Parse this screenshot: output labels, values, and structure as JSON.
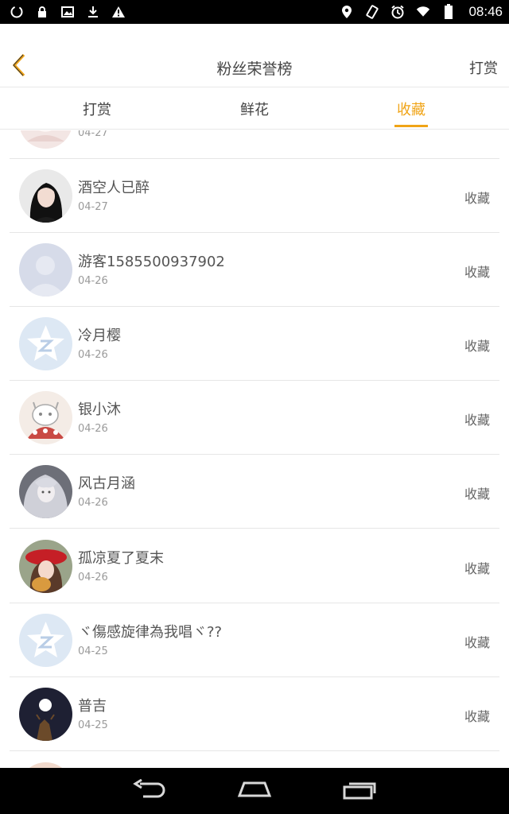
{
  "status_bar": {
    "time": "08:46",
    "left_icons": [
      "sync-icon",
      "lock-icon",
      "image-icon",
      "download-icon",
      "warning-icon"
    ],
    "right_icons": [
      "location-icon",
      "rotate-icon",
      "alarm-icon",
      "wifi-icon",
      "battery-icon"
    ]
  },
  "header": {
    "title": "粉丝荣誉榜",
    "right_label": "打赏",
    "back_icon": "chevron-left-icon",
    "accent_color": "#f0a417"
  },
  "tabs": [
    {
      "label": "打赏",
      "active": false
    },
    {
      "label": "鲜花",
      "active": false
    },
    {
      "label": "收藏",
      "active": true
    }
  ],
  "list": {
    "partial_top": {
      "date": "04-27"
    },
    "items": [
      {
        "name": "酒空人已醉",
        "date": "04-27",
        "action": "收藏",
        "avatar": "photo-dark-hair"
      },
      {
        "name": "游客1585500937902",
        "date": "04-26",
        "action": "收藏",
        "avatar": "default-person"
      },
      {
        "name": "冷月樱",
        "date": "04-26",
        "action": "收藏",
        "avatar": "qzone-default"
      },
      {
        "name": "银小沐",
        "date": "04-26",
        "action": "收藏",
        "avatar": "cartoon-cat"
      },
      {
        "name": "风古月涵",
        "date": "04-26",
        "action": "收藏",
        "avatar": "anime-girl"
      },
      {
        "name": "孤凉夏了夏末",
        "date": "04-26",
        "action": "收藏",
        "avatar": "red-hat-girl"
      },
      {
        "name": "ヾ傷感旋律為我唱ヾ??",
        "date": "04-25",
        "action": "收藏",
        "avatar": "qzone-default"
      },
      {
        "name": "普吉",
        "date": "04-25",
        "action": "收藏",
        "avatar": "moon-night"
      }
    ]
  },
  "nav_bar": {
    "icons": [
      "back-nav-icon",
      "home-nav-icon",
      "recents-nav-icon"
    ]
  }
}
